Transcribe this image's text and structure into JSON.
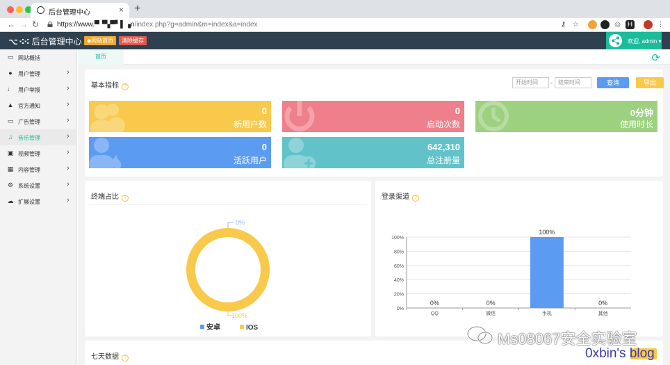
{
  "browser": {
    "tab_title": "后台管理中心",
    "close_glyph": "×",
    "new_tab_glyph": "+",
    "url_main": "https://www.▀▝▚▀▘▌▗n",
    "url_rest": "/index.php?g=admin&m=index&a=index"
  },
  "header": {
    "logo_mark": "⌥ ⁖⁖",
    "app_title": "后台管理中心",
    "site_home_label": "◆网站首页",
    "clear_cache_label": "清除缓存",
    "welcome": "欢迎, admin ▾"
  },
  "sidebar": {
    "items": [
      {
        "label": "网站概括",
        "icon": "monitor-icon",
        "chevron": ""
      },
      {
        "label": "用户管理",
        "icon": "users-icon",
        "chevron": "›"
      },
      {
        "label": "用户举报",
        "icon": "microphone-icon",
        "chevron": "›"
      },
      {
        "label": "官方通知",
        "icon": "bell-icon",
        "chevron": "›"
      },
      {
        "label": "广告管理",
        "icon": "monitor-icon",
        "chevron": "›"
      },
      {
        "label": "音乐管理",
        "icon": "music-icon",
        "chevron": "›"
      },
      {
        "label": "视频管理",
        "icon": "video-icon",
        "chevron": "›"
      },
      {
        "label": "内容管理",
        "icon": "grid-icon",
        "chevron": "›"
      },
      {
        "label": "系统设置",
        "icon": "cogs-icon",
        "chevron": "›"
      },
      {
        "label": "扩展设置",
        "icon": "cloud-icon",
        "chevron": "›"
      }
    ]
  },
  "content": {
    "breadcrumb": "首页",
    "basic": {
      "title": "基本指标",
      "start_placeholder": "开始时间",
      "end_placeholder": "结束时间",
      "range_sep": "-",
      "query_label": "查询",
      "export_label": "导出",
      "stats": [
        {
          "value": "0",
          "label": "新用户数",
          "color": "#f8c94a"
        },
        {
          "value": "0",
          "label": "启动次数",
          "color": "#ef7f8a"
        },
        {
          "value": "0分钟",
          "label": "使用时长",
          "color": "#9cd17f"
        },
        {
          "value": "0",
          "label": "活跃用户",
          "color": "#5b9cf2"
        },
        {
          "value": "642,310",
          "label": "总注册量",
          "color": "#61c3c9"
        }
      ]
    },
    "terminal": {
      "title": "终端占比",
      "help": "?"
    },
    "channel": {
      "title": "登录渠道",
      "help": "?"
    },
    "seven_days": {
      "title": "七天数据"
    }
  },
  "chart_data": [
    {
      "type": "pie",
      "title": "终端占比",
      "labels": [
        "安卓",
        "IOS"
      ],
      "values": [
        0,
        100
      ],
      "data_labels": [
        "0%",
        "100%"
      ],
      "colors": [
        "#5b9cf2",
        "#f8c94a"
      ],
      "legend": "bottom"
    },
    {
      "type": "bar",
      "title": "登录渠道",
      "categories": [
        "QQ",
        "微信",
        "手机",
        "其他"
      ],
      "values": [
        0,
        0,
        100,
        0
      ],
      "data_labels": [
        "0%",
        "0%",
        "100%",
        "0%"
      ],
      "ylim": [
        0,
        100
      ],
      "yticks": [
        "0%",
        "20%",
        "40%",
        "60%",
        "80%",
        "100%"
      ],
      "bar_color": "#5b9cf2",
      "grid": true
    }
  ],
  "watermark": {
    "text": "Ms08067安全实验室",
    "blog": "0xbin's blog"
  }
}
